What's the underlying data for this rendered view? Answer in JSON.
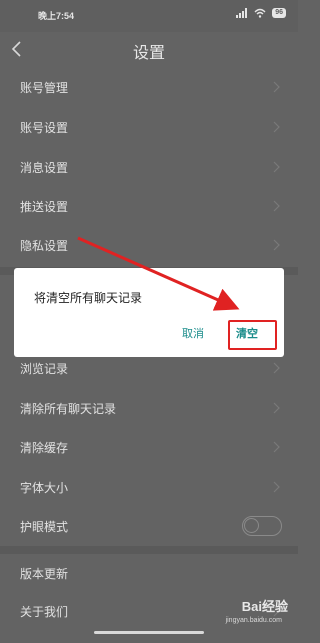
{
  "status_bar": {
    "time": "晚上7:54",
    "battery": "96"
  },
  "header": {
    "title": "设置"
  },
  "settings": [
    {
      "label": "账号管理",
      "type": "chevron"
    },
    {
      "label": "账号设置",
      "type": "chevron"
    },
    {
      "label": "消息设置",
      "type": "chevron"
    },
    {
      "label": "推送设置",
      "type": "chevron"
    },
    {
      "label": "隐私设置",
      "type": "chevron"
    },
    {
      "label": "浏览记录",
      "type": "chevron"
    },
    {
      "label": "清除所有聊天记录",
      "type": "chevron"
    },
    {
      "label": "清除缓存",
      "type": "chevron"
    },
    {
      "label": "字体大小",
      "type": "chevron"
    },
    {
      "label": "护眼模式",
      "type": "toggle",
      "enabled": false
    },
    {
      "label": "版本更新",
      "type": "none"
    },
    {
      "label": "关于我们",
      "type": "chevron"
    }
  ],
  "dialog": {
    "message": "将清空所有聊天记录",
    "cancel_label": "取消",
    "confirm_label": "清空"
  },
  "watermark": {
    "brand": "Bai经验",
    "url": "jingyan.baidu.com"
  },
  "colors": {
    "accent": "#1a8c8a",
    "annotation": "#e02222",
    "overlay_bg": "#636363"
  }
}
